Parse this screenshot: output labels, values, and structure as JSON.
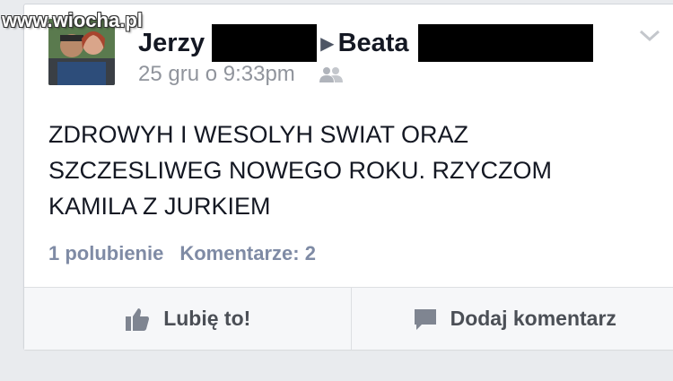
{
  "watermark": "www.wiocha.pl",
  "post": {
    "author": "Jerzy",
    "arrow": "▶",
    "recipient": "Beata",
    "timestamp": "25 gru o 9:33pm",
    "audience_icon": "friends-icon",
    "text": "ZDROWYH I WESOLYH SWIAT ORAZ\nSZCZESLIWEG  NOWEGO  ROKU. RZYCZOM\nKAMILA Z JURKIEM",
    "likes": "1 polubienie",
    "comments": "Komentarze: 2"
  },
  "actions": {
    "like_label": "Lubię to!",
    "comment_label": "Dodaj komentarz"
  },
  "colors": {
    "background": "#e9ebee",
    "card": "#ffffff",
    "text": "#141823",
    "muted": "#90949c",
    "stats": "#7f8ba5",
    "action_text": "#4b4f56"
  }
}
